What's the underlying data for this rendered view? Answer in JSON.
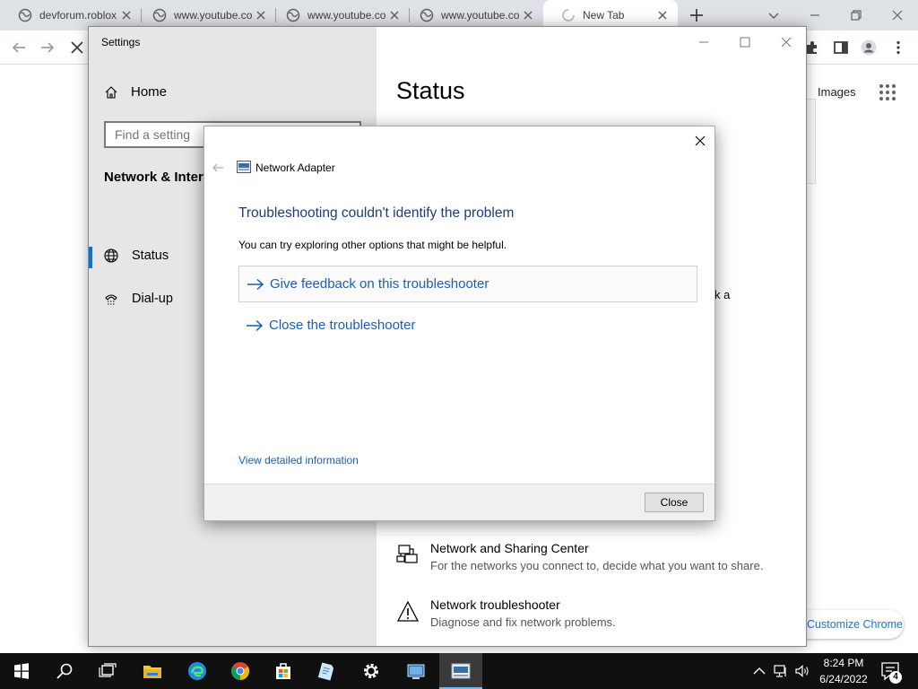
{
  "browser": {
    "tabs": [
      {
        "title": "devforum.roblox",
        "icon": "globe-icon"
      },
      {
        "title": "www.youtube.com",
        "icon": "globe-icon"
      },
      {
        "title": "www.youtube.com",
        "icon": "globe-icon"
      },
      {
        "title": "www.youtube.com",
        "icon": "globe-icon"
      },
      {
        "title": "New Tab",
        "icon": "loading-spinner-icon"
      }
    ],
    "ntp": {
      "images_link": "Images",
      "customize_button": "Customize Chrome"
    }
  },
  "settings": {
    "window_title": "Settings",
    "home_label": "Home",
    "search_placeholder": "Find a setting",
    "section_heading": "Network & Internet",
    "nav": [
      {
        "label": "Status",
        "icon": "globe-network-icon",
        "selected": true
      },
      {
        "label": "Dial-up",
        "icon": "dial-up-icon",
        "selected": false
      }
    ],
    "page_title": "Status",
    "partial_text": "k a",
    "links": [
      {
        "title": "Network and Sharing Center",
        "desc": "For the networks you connect to, decide what you want to share.",
        "icon": "network-sharing-icon"
      },
      {
        "title": "Network troubleshooter",
        "desc": "Diagnose and fix network problems.",
        "icon": "warning-triangle-icon"
      }
    ]
  },
  "dialog": {
    "app_title": "Network Adapter",
    "heading": "Troubleshooting couldn't identify the problem",
    "subtext": "You can try exploring other options that might be helpful.",
    "options": [
      "Give feedback on this troubleshooter",
      "Close the troubleshooter"
    ],
    "details_link": "View detailed information",
    "close_button": "Close"
  },
  "taskbar": {
    "time": "8:24 PM",
    "date": "6/24/2022",
    "notification_count": "4",
    "apps": [
      "file-explorer-icon",
      "edge-icon",
      "chrome-icon",
      "store-icon",
      "notepad-icon",
      "settings-gear-icon",
      "control-panel-icon",
      "network-adapter-icon"
    ]
  },
  "colors": {
    "accent": "#0078d4",
    "link_blue": "#1a5fb4",
    "heading_blue": "#1e3c78",
    "taskbar": "#101010"
  }
}
